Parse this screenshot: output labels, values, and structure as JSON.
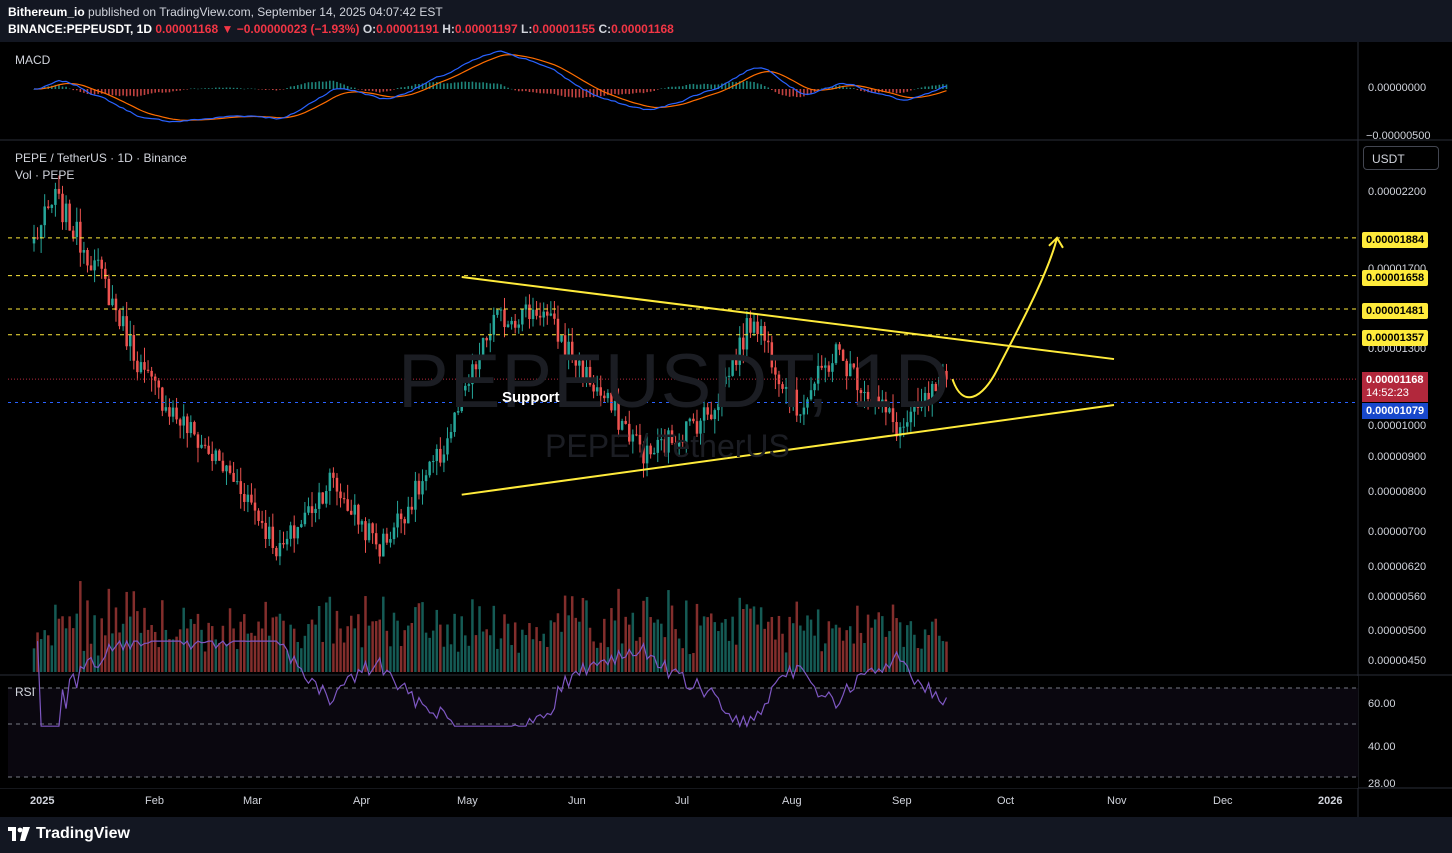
{
  "header": {
    "publisher": "Bithereum_io",
    "published_text": " published on TradingView.com, September 14, 2025 04:07:42 EST",
    "symbol_line": "BINANCE:PEPEUSDT, 1D",
    "last": "0.00001168",
    "change": "−0.00000023 (−1.93%)",
    "o_label": "O:",
    "o": "0.00001191",
    "h_label": "H:",
    "h": "0.00001197",
    "l_label": "L:",
    "l": "0.00001155",
    "c_label": "C:",
    "c": "0.00001168"
  },
  "macd_pane": {
    "label": "MACD",
    "y_labels": [
      "0.00000000",
      "−0.00000500"
    ]
  },
  "main_pane": {
    "title": "PEPE / TetherUS · 1D · Binance",
    "vol_label": "Vol · PEPE",
    "currency_button": "USDT",
    "watermark_symbol": "PEPEUSDT, 1D",
    "watermark_name": "PEPE / TetherUS",
    "annotation": "Support",
    "y_labels": [
      "0.00002200",
      "0.00001700",
      "0.00001300",
      "0.00001000",
      "0.00000900",
      "0.00000800",
      "0.00000700",
      "0.00000620",
      "0.00000560",
      "0.00000500",
      "0.00000450"
    ],
    "level_tags": [
      "0.00001884",
      "0.00001658",
      "0.00001481",
      "0.00001357"
    ],
    "current_price": "0.00001168",
    "countdown": "14:52:23",
    "blue_level": "0.00001079"
  },
  "rsi_pane": {
    "label": "RSI",
    "y_labels": [
      "60.00",
      "40.00",
      "28.00"
    ]
  },
  "x_axis": [
    "2025",
    "Feb",
    "Mar",
    "Apr",
    "May",
    "Jun",
    "Jul",
    "Aug",
    "Sep",
    "Oct",
    "Nov",
    "Dec",
    "2026"
  ],
  "footer": {
    "brand": "TradingView"
  },
  "colors": {
    "up": "#26a69a",
    "down": "#ef5350",
    "yellow": "#ffeb3b",
    "macd": "#2962ff",
    "signal": "#ff6d00",
    "rsi": "#7e57c2",
    "background": "#000000",
    "header_bg": "#131722"
  },
  "chart_data": {
    "type": "candlestick",
    "title": "PEPE / TetherUS · 1D · Binance",
    "interval": "1D",
    "x_range": [
      "2025-01-01",
      "2026-01-01"
    ],
    "y_scale": "log",
    "last_price": 1.168e-05,
    "horizontal_levels": [
      1.884e-05,
      1.658e-05,
      1.481e-05,
      1.357e-05,
      1.079e-05
    ],
    "trendlines": [
      {
        "name": "descending resistance",
        "points": [
          [
            "2025-05-01",
            1.65e-05
          ],
          [
            "2025-10-31",
            1.25e-05
          ]
        ]
      },
      {
        "name": "ascending support",
        "points": [
          [
            "2025-05-01",
            7.9e-06
          ],
          [
            "2025-10-31",
            1.07e-05
          ]
        ]
      }
    ],
    "projection": "bounce from support then breakout toward 0.00001884",
    "approx_closes": [
      {
        "date": "2025-01-01",
        "close": 1.87e-05
      },
      {
        "date": "2025-01-07",
        "close": 2.15e-05
      },
      {
        "date": "2025-01-20",
        "close": 1.65e-05
      },
      {
        "date": "2025-02-01",
        "close": 1.18e-05
      },
      {
        "date": "2025-02-10",
        "close": 1.03e-05
      },
      {
        "date": "2025-03-01",
        "close": 8e-06
      },
      {
        "date": "2025-03-11",
        "close": 6.5e-06
      },
      {
        "date": "2025-03-25",
        "close": 8.3e-06
      },
      {
        "date": "2025-04-08",
        "close": 6.6e-06
      },
      {
        "date": "2025-04-25",
        "close": 9e-06
      },
      {
        "date": "2025-05-10",
        "close": 1.42e-05
      },
      {
        "date": "2025-05-23",
        "close": 1.48e-05
      },
      {
        "date": "2025-06-05",
        "close": 1.18e-05
      },
      {
        "date": "2025-06-22",
        "close": 9e-06
      },
      {
        "date": "2025-07-10",
        "close": 1.05e-05
      },
      {
        "date": "2025-07-22",
        "close": 1.45e-05
      },
      {
        "date": "2025-08-03",
        "close": 1.05e-05
      },
      {
        "date": "2025-08-14",
        "close": 1.28e-05
      },
      {
        "date": "2025-09-01",
        "close": 9.8e-06
      },
      {
        "date": "2025-09-14",
        "close": 1.168e-05
      }
    ]
  }
}
